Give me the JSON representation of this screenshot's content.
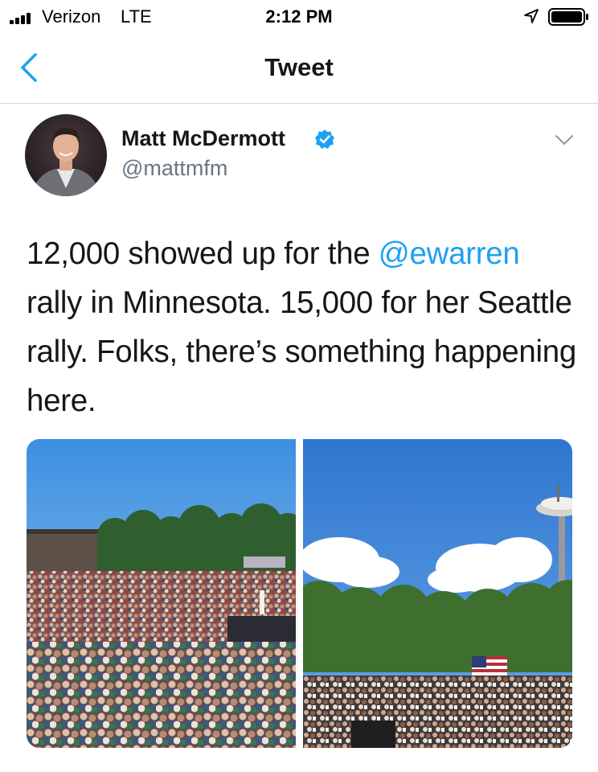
{
  "status_bar": {
    "carrier": "Verizon",
    "network": "LTE",
    "time": "2:12 PM",
    "icons": [
      "signal-bars-icon",
      "location-arrow-icon",
      "battery-icon"
    ]
  },
  "nav": {
    "title": "Tweet",
    "back_icon": "chevron-left-icon"
  },
  "tweet": {
    "author_name": "Matt McDermott",
    "handle": "@mattmfm",
    "verified": true,
    "text_before": "12,000 showed up for the ",
    "mention": "@ewarren",
    "text_after": " rally in Minnesota. 15,000 for her Seattle rally. Folks, there’s something happening here.",
    "menu_icon": "chevron-down-icon"
  },
  "colors": {
    "link": "#1da1f2",
    "handle_gray": "#657786",
    "divider": "#d6d6d6",
    "text": "#14171a"
  }
}
